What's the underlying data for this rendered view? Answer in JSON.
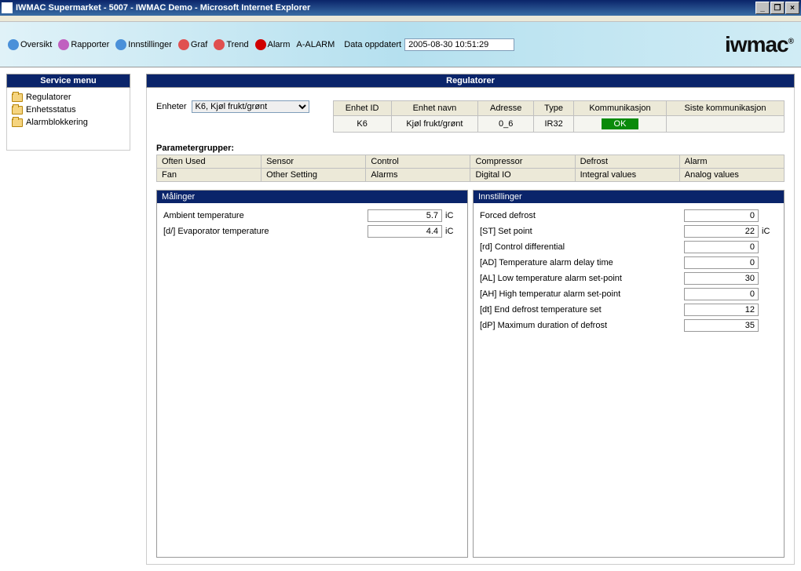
{
  "window": {
    "title": "IWMAC Supermarket - 5007 - IWMAC Demo - Microsoft Internet Explorer"
  },
  "toolbar": {
    "items": [
      {
        "label": "Oversikt",
        "icon_color": "#4a90d9"
      },
      {
        "label": "Rapporter",
        "icon_color": "#c060c0"
      },
      {
        "label": "Innstillinger",
        "icon_color": "#4a90d9"
      },
      {
        "label": "Graf",
        "icon_color": "#e05050"
      },
      {
        "label": "Trend",
        "icon_color": "#e05050"
      },
      {
        "label": "Alarm",
        "icon_color": "#d00000"
      },
      {
        "label": "A-ALARM",
        "icon_color": ""
      }
    ],
    "update_label": "Data oppdatert",
    "update_value": "2005-08-30 10:51:29"
  },
  "logo": "iwmac",
  "sidebar": {
    "title": "Service menu",
    "items": [
      {
        "label": "Regulatorer"
      },
      {
        "label": "Enhetsstatus"
      },
      {
        "label": "Alarmblokkering"
      }
    ]
  },
  "main": {
    "title": "Regulatorer",
    "enheter_label": "Enheter",
    "enheter_selected": "K6, Kjøl frukt/grønt",
    "unit_table": {
      "headers": [
        "Enhet ID",
        "Enhet navn",
        "Adresse",
        "Type",
        "Kommunikasjon",
        "Siste kommunikasjon"
      ],
      "row": {
        "id": "K6",
        "name": "Kjøl frukt/grønt",
        "addr": "0_6",
        "type": "IR32",
        "comm": "OK",
        "last": ""
      }
    },
    "param_label": "Parametergrupper:",
    "param_groups": [
      [
        "Often Used",
        "Sensor",
        "Control",
        "Compressor",
        "Defrost",
        "Alarm"
      ],
      [
        "Fan",
        "Other Setting",
        "Alarms",
        "Digital IO",
        "Integral values",
        "Analog values"
      ]
    ],
    "measurements": {
      "title": "Målinger",
      "rows": [
        {
          "label": "Ambient temperature",
          "value": "5.7",
          "unit": "iC"
        },
        {
          "label": "[d/] Evaporator temperature",
          "value": "4.4",
          "unit": "iC"
        }
      ]
    },
    "settings": {
      "title": "Innstillinger",
      "rows": [
        {
          "label": "Forced defrost",
          "value": "0",
          "unit": ""
        },
        {
          "label": "[ST] Set point",
          "value": "22",
          "unit": "iC"
        },
        {
          "label": "[rd] Control differential",
          "value": "0",
          "unit": ""
        },
        {
          "label": "[AD] Temperature alarm delay time",
          "value": "0",
          "unit": ""
        },
        {
          "label": "[AL] Low temperature alarm set-point",
          "value": "30",
          "unit": ""
        },
        {
          "label": "[AH] High temperatur alarm set-point",
          "value": "0",
          "unit": ""
        },
        {
          "label": "[dt] End defrost temperature set",
          "value": "12",
          "unit": ""
        },
        {
          "label": "[dP] Maximum duration of defrost",
          "value": "35",
          "unit": ""
        }
      ]
    }
  }
}
